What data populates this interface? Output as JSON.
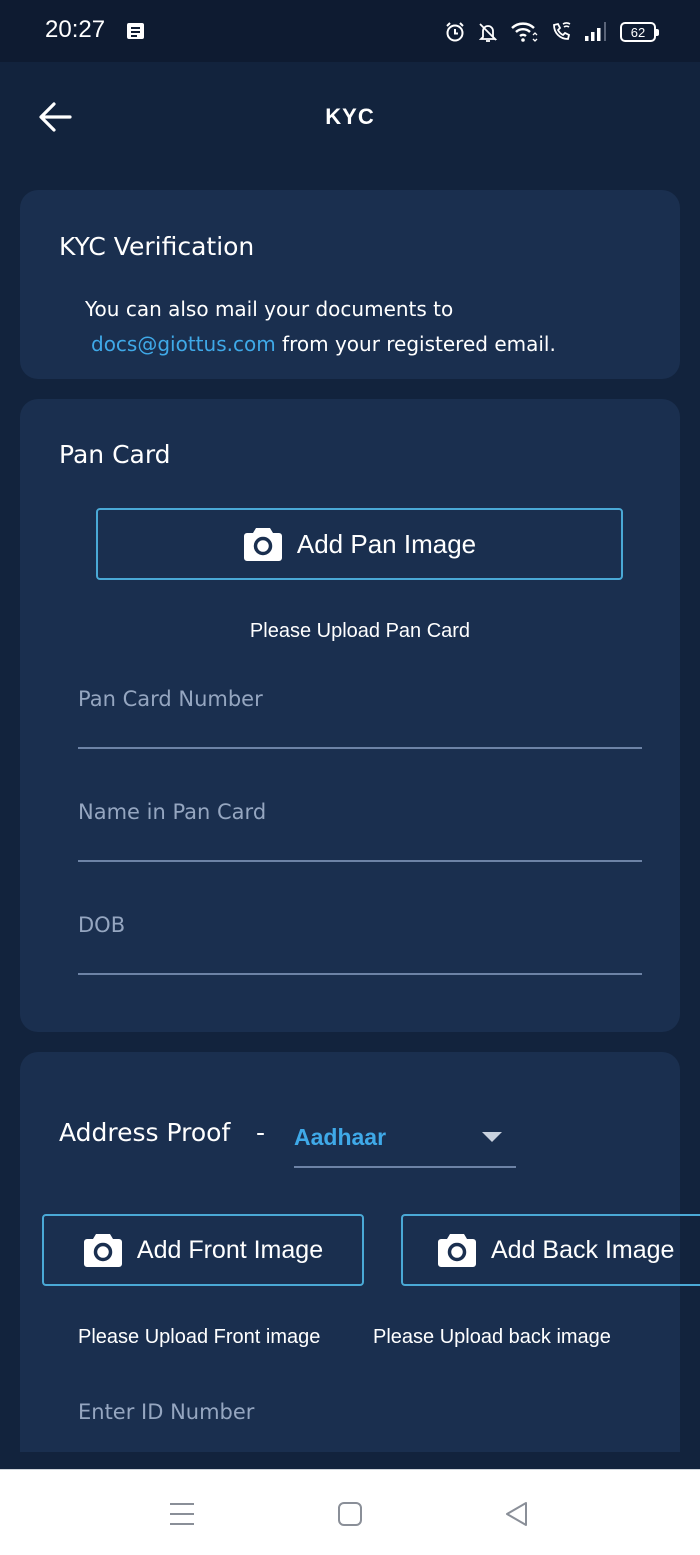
{
  "status_bar": {
    "time": "20:27",
    "notification_icon": "notes-icon",
    "icons": [
      "alarm-icon",
      "bell-off-icon",
      "wifi-icon",
      "wifi-calling-icon",
      "signal-icon"
    ],
    "battery": "62"
  },
  "app_bar": {
    "back_icon": "arrow-left-icon",
    "title": "KYC"
  },
  "kyc_card": {
    "title": "KYC Verification",
    "line1": "You can also mail your documents to",
    "email": "docs@giottus.com",
    "line2_suffix": " from your registered email."
  },
  "pan_card": {
    "title": "Pan Card",
    "add_button": "Add Pan Image",
    "helper": "Please Upload Pan Card",
    "fields": [
      {
        "placeholder": "Pan Card Number",
        "value": ""
      },
      {
        "placeholder": "Name in Pan Card",
        "value": ""
      },
      {
        "placeholder": "DOB",
        "value": ""
      }
    ]
  },
  "address_card": {
    "label": "Address Proof",
    "separator": "-",
    "selected": "Aadhaar",
    "front_button": "Add Front Image",
    "back_button": "Add Back Image",
    "front_helper": "Please Upload Front image",
    "back_helper": "Please Upload back image",
    "id_field": {
      "placeholder": "Enter ID Number",
      "value": ""
    }
  },
  "nav_bar": {
    "buttons": [
      "menu-icon",
      "home-icon",
      "back-icon"
    ]
  },
  "colors": {
    "background": "#12233d",
    "card": "#1a2f4f",
    "accent": "#3fa9e8",
    "button_border": "#4aa9d6",
    "placeholder": "#95a6c0"
  }
}
